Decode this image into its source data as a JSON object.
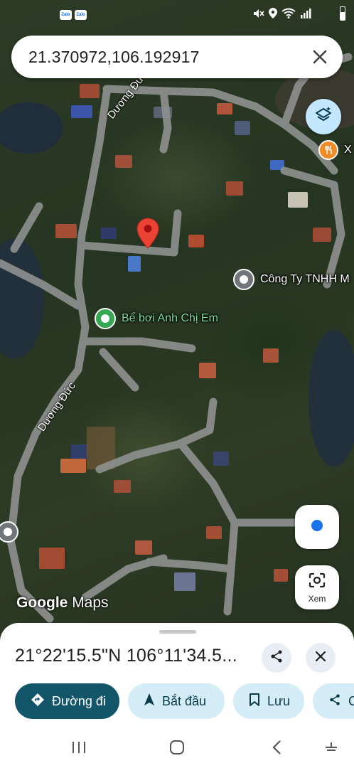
{
  "status_bar": {
    "left_apps": [
      "Zalo",
      "Zalo"
    ]
  },
  "search": {
    "value": "21.370972,106.192917",
    "close_icon": "close-icon"
  },
  "map": {
    "road_labels": [
      "Dương Đức",
      "Dương Đức"
    ],
    "pois": [
      {
        "name": "Bể bơi Anh Chị Em",
        "color": "#7fd99a"
      },
      {
        "name": "Công Ty TNHH M",
        "color": "#ffffff"
      },
      {
        "name": "X",
        "color": "#ffffff"
      }
    ],
    "logo_google": "Google",
    "logo_maps": "Maps",
    "lens_label": "Xem",
    "pin_color": "#ea4335"
  },
  "sheet": {
    "coordinates": "21°22'15.5\"N 106°11'34.5...",
    "actions": [
      {
        "label": "Đường đi",
        "icon": "directions-icon"
      },
      {
        "label": "Bắt đầu",
        "icon": "navigation-arrow-icon"
      },
      {
        "label": "Lưu",
        "icon": "bookmark-icon"
      },
      {
        "label": "C",
        "icon": "share-icon"
      }
    ]
  },
  "colors": {
    "primary_chip": "#13566a",
    "secondary_chip": "#d4edf7",
    "layers_button": "#c2e7ff",
    "location_dot": "#1a73e8"
  }
}
